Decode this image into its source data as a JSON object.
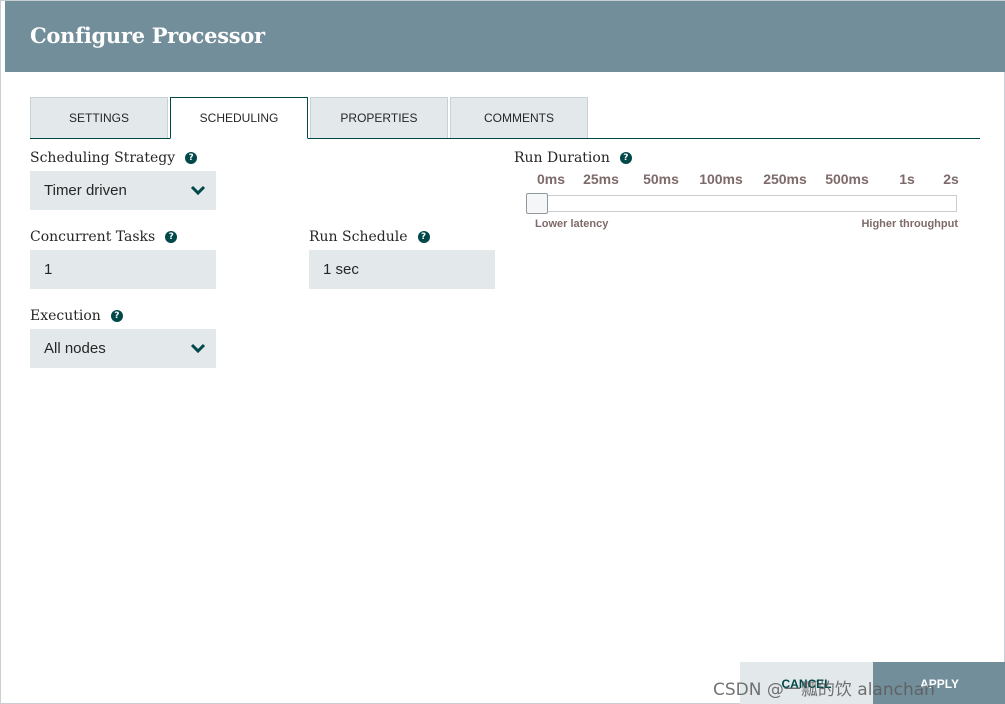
{
  "header": {
    "title": "Configure Processor"
  },
  "tabs": [
    {
      "label": "SETTINGS"
    },
    {
      "label": "SCHEDULING"
    },
    {
      "label": "PROPERTIES"
    },
    {
      "label": "COMMENTS"
    }
  ],
  "scheduling_strategy": {
    "label": "Scheduling Strategy",
    "value": "Timer driven"
  },
  "concurrent_tasks": {
    "label": "Concurrent Tasks",
    "value": "1"
  },
  "run_schedule": {
    "label": "Run Schedule",
    "value": "1 sec"
  },
  "execution": {
    "label": "Execution",
    "value": "All nodes"
  },
  "run_duration": {
    "label": "Run Duration",
    "ticks": [
      "0ms",
      "25ms",
      "50ms",
      "100ms",
      "250ms",
      "500ms",
      "1s",
      "2s"
    ],
    "selected": "0ms",
    "low_label": "Lower latency",
    "high_label": "Higher throughput"
  },
  "icons": {
    "help": "?"
  },
  "buttons": {
    "cancel": "CANCEL",
    "apply": "APPLY"
  },
  "watermark": "CSDN @一瓢的饮 alanchan",
  "colors": {
    "header": "#728e9b",
    "accent": "#004849",
    "field_bg": "#e3e8eb",
    "slider_text": "#7e6a6a"
  }
}
